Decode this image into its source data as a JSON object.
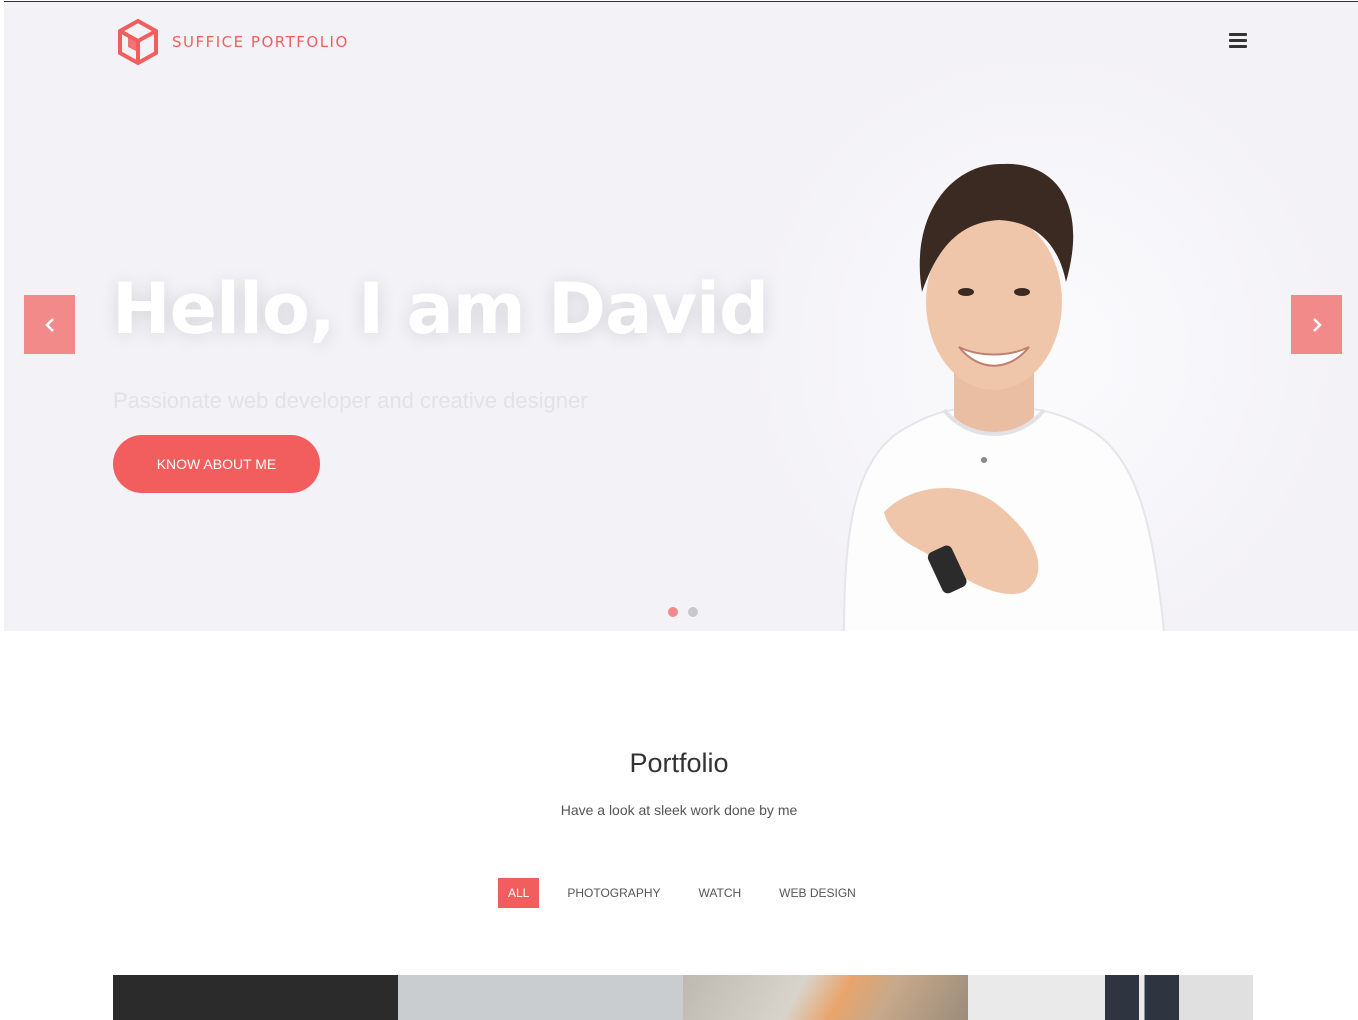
{
  "brand": {
    "name_part1": "SUFFICE",
    "name_part2": "PORTFOLIO",
    "accent": "#f25e5e"
  },
  "header": {
    "menu_icon": "hamburger-icon"
  },
  "hero": {
    "title": "Hello, I am David",
    "subtitle": "Passionate web developer and creative designer",
    "button_label": "KNOW ABOUT ME",
    "prev_icon": "chevron-left-icon",
    "next_icon": "chevron-right-icon",
    "slide_count": 2,
    "active_slide": 1
  },
  "portfolio": {
    "title": "Portfolio",
    "subtitle": "Have a look at sleek work done by me",
    "filters": [
      {
        "label": "ALL",
        "active": true
      },
      {
        "label": "PHOTOGRAPHY",
        "active": false
      },
      {
        "label": "WATCH",
        "active": false
      },
      {
        "label": "WEB DESIGN",
        "active": false
      }
    ],
    "thumb_colors": [
      "#2b2b2b",
      "#c9cdcf",
      "#b8b2a8",
      "#e6e6e6"
    ]
  }
}
